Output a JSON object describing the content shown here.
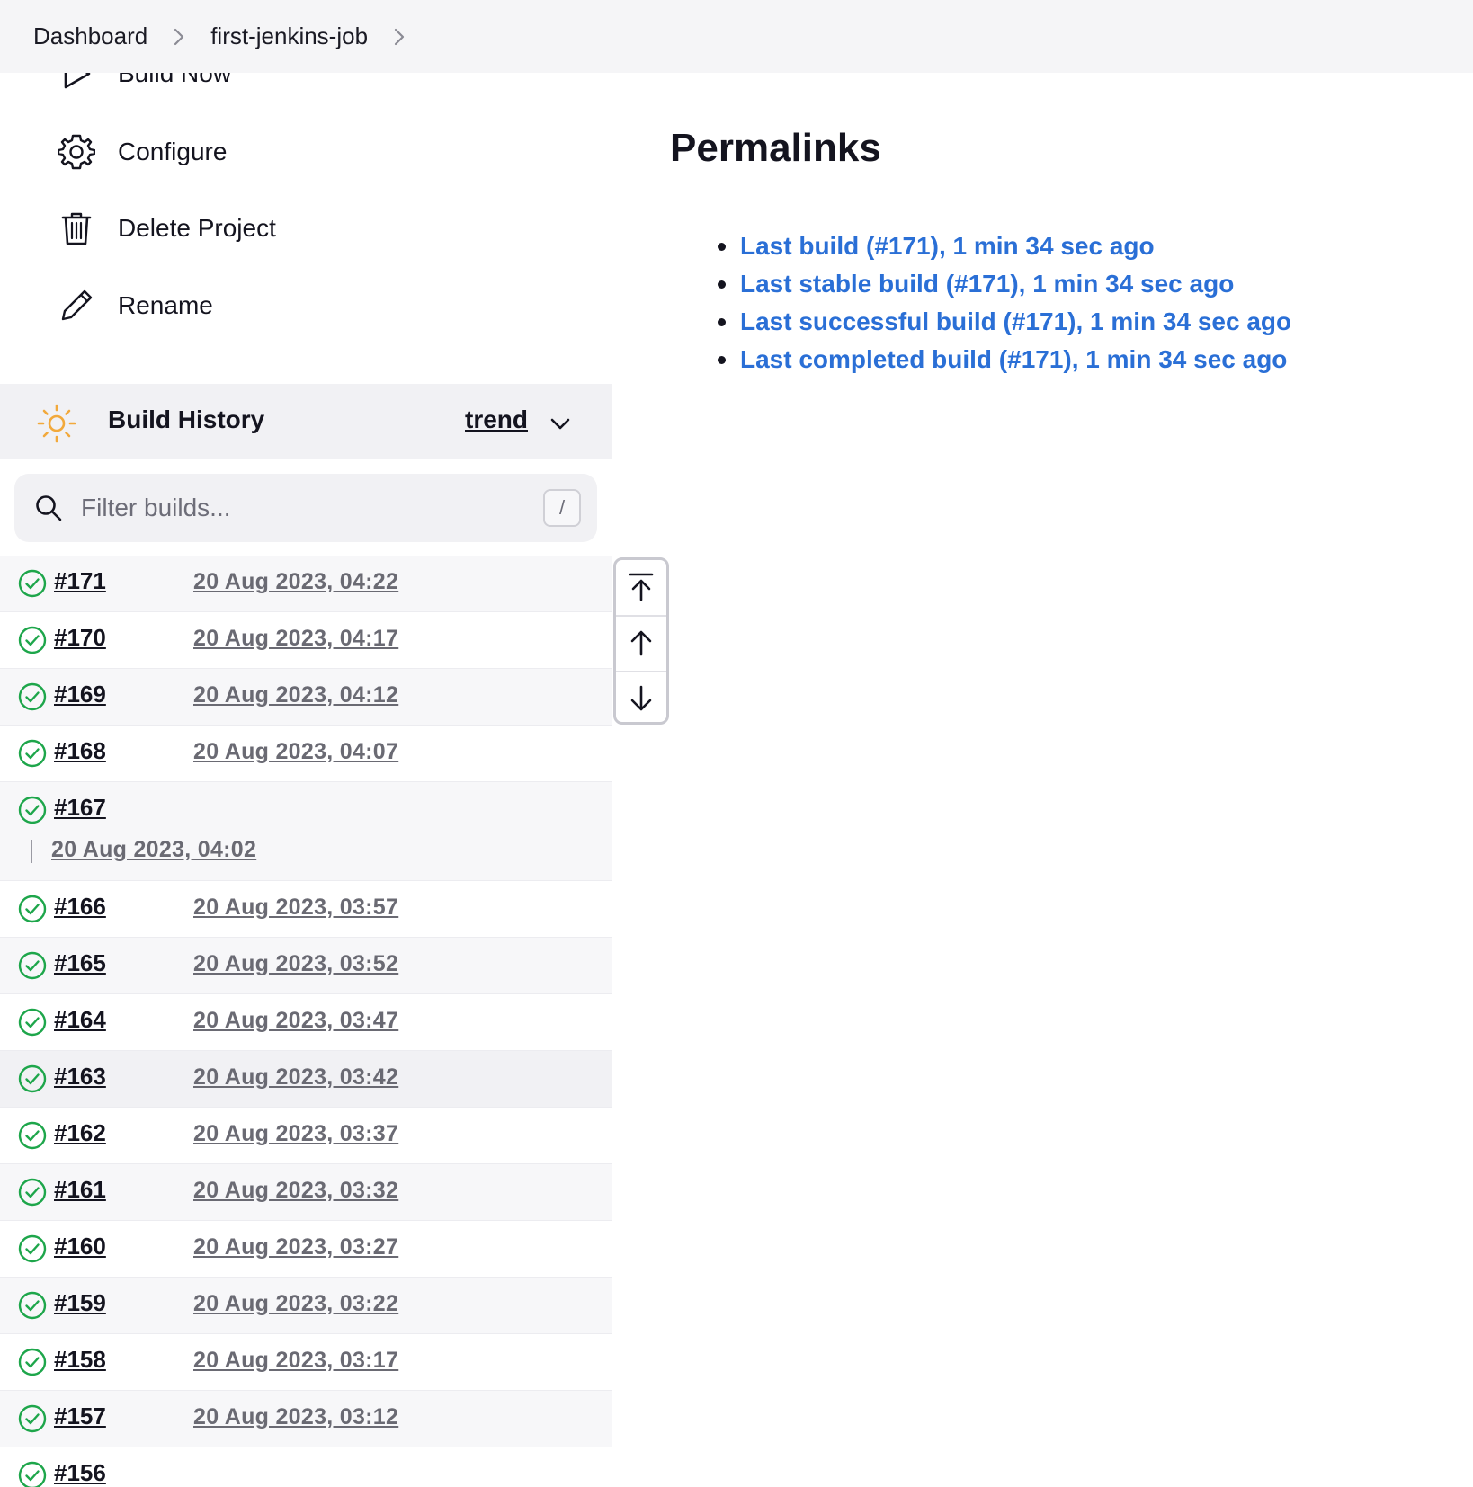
{
  "breadcrumb": {
    "items": [
      {
        "label": "Dashboard"
      },
      {
        "label": "first-jenkins-job"
      }
    ]
  },
  "tasks": [
    {
      "label": "Build Now",
      "icon": "play-icon"
    },
    {
      "label": "Configure",
      "icon": "gear-icon"
    },
    {
      "label": "Delete Project",
      "icon": "trash-icon"
    },
    {
      "label": "Rename",
      "icon": "pencil-icon"
    }
  ],
  "build_history": {
    "title": "Build History",
    "trend_label": "trend",
    "filter_placeholder": "Filter builds...",
    "shortcut_hint": "/",
    "builds": [
      {
        "number": "#171",
        "date": "20 Aug 2023, 04:22"
      },
      {
        "number": "#170",
        "date": "20 Aug 2023, 04:17"
      },
      {
        "number": "#169",
        "date": "20 Aug 2023, 04:12"
      },
      {
        "number": "#168",
        "date": "20 Aug 2023, 04:07"
      },
      {
        "number": "#167",
        "date": "20 Aug 2023, 04:02"
      },
      {
        "number": "#166",
        "date": "20 Aug 2023, 03:57"
      },
      {
        "number": "#165",
        "date": "20 Aug 2023, 03:52"
      },
      {
        "number": "#164",
        "date": "20 Aug 2023, 03:47"
      },
      {
        "number": "#163",
        "date": "20 Aug 2023, 03:42"
      },
      {
        "number": "#162",
        "date": "20 Aug 2023, 03:37"
      },
      {
        "number": "#161",
        "date": "20 Aug 2023, 03:32"
      },
      {
        "number": "#160",
        "date": "20 Aug 2023, 03:27"
      },
      {
        "number": "#159",
        "date": "20 Aug 2023, 03:22"
      },
      {
        "number": "#158",
        "date": "20 Aug 2023, 03:17"
      },
      {
        "number": "#157",
        "date": "20 Aug 2023, 03:12"
      },
      {
        "number": "#156",
        "date": ""
      }
    ]
  },
  "permalinks": {
    "title": "Permalinks",
    "links": [
      {
        "label": "Last build (#171), 1 min 34 sec ago"
      },
      {
        "label": "Last stable build (#171), 1 min 34 sec ago"
      },
      {
        "label": "Last successful build (#171), 1 min 34 sec ago"
      },
      {
        "label": "Last completed build (#171), 1 min 34 sec ago"
      }
    ]
  },
  "colors": {
    "link_blue": "#2a6fd6",
    "success_green": "#1ea64b",
    "sun_orange": "#f2a93b",
    "panel_gray": "#f1f1f4"
  }
}
